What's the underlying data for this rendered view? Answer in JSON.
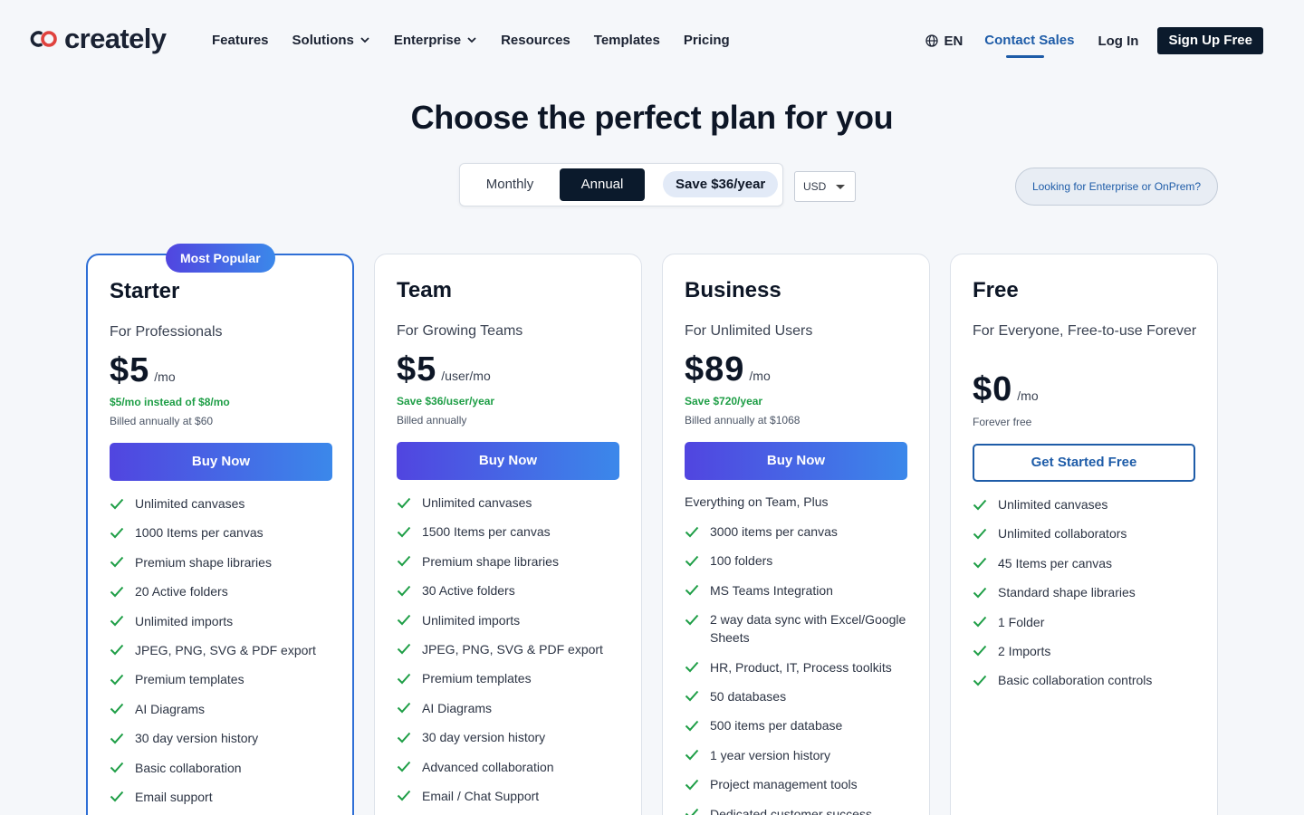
{
  "brand": {
    "name": "creately",
    "accent": "#1e5ca8",
    "dark": "#0b1a2c",
    "green": "#1e9e46"
  },
  "nav": {
    "items": [
      {
        "label": "Features",
        "dropdown": false
      },
      {
        "label": "Solutions",
        "dropdown": true
      },
      {
        "label": "Enterprise",
        "dropdown": true
      },
      {
        "label": "Resources",
        "dropdown": false
      },
      {
        "label": "Templates",
        "dropdown": false
      },
      {
        "label": "Pricing",
        "dropdown": false
      }
    ],
    "language": "EN",
    "contact_sales": "Contact Sales",
    "login": "Log In",
    "signup": "Sign Up Free"
  },
  "page": {
    "title": "Choose the perfect plan for you"
  },
  "billing": {
    "monthly": "Monthly",
    "annual": "Annual",
    "selected": "Annual",
    "save": "Save $36/year",
    "currency": "USD",
    "enterprise_link": "Looking for Enterprise or OnPrem?"
  },
  "plans": [
    {
      "name": "Starter",
      "tagline": "For Professionals",
      "badge": "Most Popular",
      "price": "$5",
      "unit": "/mo",
      "save_note": "$5/mo instead of $8/mo",
      "billed": "Billed annually at $60",
      "cta": "Buy Now",
      "intro": "",
      "features": [
        "Unlimited canvases",
        "1000 Items per canvas",
        "Premium shape libraries",
        "20 Active folders",
        "Unlimited imports",
        "JPEG, PNG, SVG & PDF export",
        "Premium templates",
        "AI Diagrams",
        "30 day version history",
        "Basic collaboration",
        "Email support"
      ]
    },
    {
      "name": "Team",
      "tagline": "For Growing Teams",
      "badge": "",
      "price": "$5",
      "unit": "/user/mo",
      "save_note": "Save $36/user/year",
      "billed": "Billed annually",
      "cta": "Buy Now",
      "intro": "",
      "features": [
        "Unlimited canvases",
        "1500 Items per canvas",
        "Premium shape libraries",
        "30 Active folders",
        "Unlimited imports",
        "JPEG, PNG, SVG & PDF export",
        "Premium templates",
        "AI Diagrams",
        "30 day version history",
        "Advanced collaboration",
        "Email / Chat Support"
      ]
    },
    {
      "name": "Business",
      "tagline": "For Unlimited Users",
      "badge": "",
      "price": "$89",
      "unit": "/mo",
      "save_note": "Save $720/year",
      "billed": "Billed annually at $1068",
      "cta": "Buy Now",
      "intro": "Everything on Team, Plus",
      "features": [
        "3000 items per canvas",
        "100 folders",
        "MS Teams Integration",
        "2 way data sync with Excel/Google Sheets",
        "HR, Product, IT, Process toolkits",
        "50 databases",
        "500 items per database",
        "1 year version history",
        "Project management tools",
        "Dedicated customer success"
      ]
    },
    {
      "name": "Free",
      "tagline": "For Everyone, Free-to-use Forever",
      "badge": "",
      "price": "$0",
      "unit": "/mo",
      "save_note": "",
      "billed": "Forever free",
      "cta": "Get Started Free",
      "intro": "",
      "features": [
        "Unlimited canvases",
        "Unlimited collaborators",
        "45 Items per canvas",
        "Standard shape libraries",
        "1 Folder",
        "2 Imports",
        "Basic collaboration controls"
      ]
    }
  ]
}
